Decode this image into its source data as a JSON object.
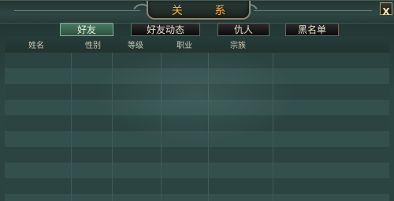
{
  "window": {
    "title": "关 系",
    "close_label": "X"
  },
  "tabs": [
    {
      "label": "好友",
      "active": true
    },
    {
      "label": "好友动态",
      "active": false
    },
    {
      "label": "仇人",
      "active": false
    },
    {
      "label": "黑名单",
      "active": false
    }
  ],
  "table": {
    "columns": [
      "姓名",
      "性别",
      "等级",
      "职业",
      "宗族"
    ],
    "rows": []
  },
  "colors": {
    "title_text": "#f0b650",
    "active_tab": "#4b7a64",
    "row_a": "#2b4441",
    "row_b": "#34504d"
  }
}
